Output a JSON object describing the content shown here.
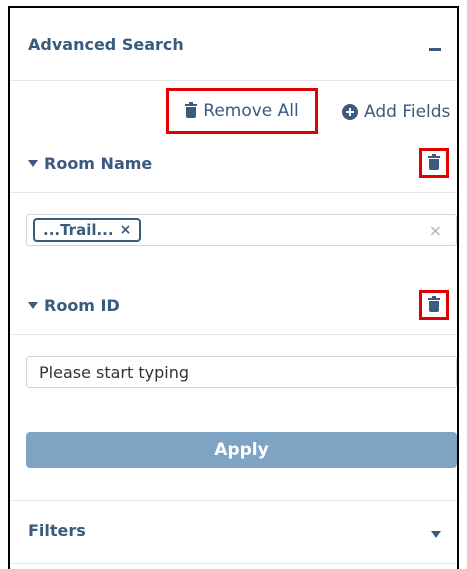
{
  "panel": {
    "title": "Advanced Search",
    "collapse_icon": "minus-icon"
  },
  "actions": {
    "remove_all_label": "Remove All",
    "remove_all_icon": "trash-icon",
    "add_fields_label": "Add Fields",
    "add_fields_icon": "plus-circle-icon"
  },
  "fields": [
    {
      "label": "Room Name",
      "expanded": true,
      "tag": "...Trail...",
      "tag_remove": "×",
      "clear": "×"
    },
    {
      "label": "Room ID",
      "expanded": true,
      "placeholder": "Please start typing"
    }
  ],
  "apply_label": "Apply",
  "filters_label": "Filters",
  "colors": {
    "accent": "#3a5a7e",
    "apply_bg": "#7fa3c3",
    "highlight": "#e00000"
  }
}
